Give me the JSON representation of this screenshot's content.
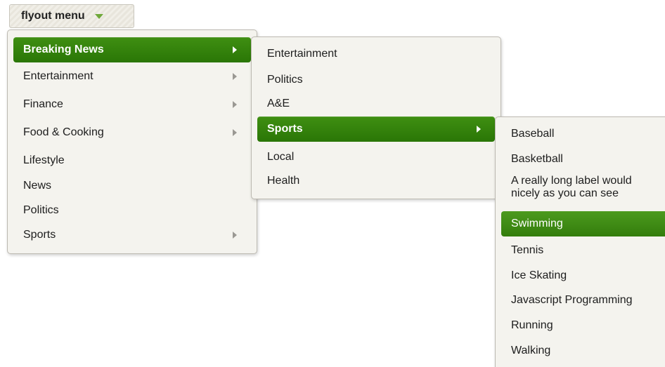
{
  "trigger": {
    "label": "flyout menu",
    "caret_icon": "caret-down-icon",
    "caret_color": "#6fa83a"
  },
  "colors": {
    "active_green": "#2f7a09",
    "panel_bg": "#f4f3ee"
  },
  "menu_level_1": {
    "items": [
      {
        "label": "Breaking News",
        "has_submenu": true,
        "active": true
      },
      {
        "label": "Entertainment",
        "has_submenu": true
      },
      {
        "label": "Finance",
        "has_submenu": true
      },
      {
        "label": "Food & Cooking",
        "has_submenu": true
      },
      {
        "label": "Lifestyle",
        "has_submenu": false
      },
      {
        "label": "News",
        "has_submenu": false
      },
      {
        "label": "Politics",
        "has_submenu": false
      },
      {
        "label": "Sports",
        "has_submenu": true
      }
    ]
  },
  "menu_level_2": {
    "items": [
      {
        "label": "Entertainment",
        "has_submenu": false
      },
      {
        "label": "Politics",
        "has_submenu": false
      },
      {
        "label": "A&E",
        "has_submenu": false
      },
      {
        "label": "Sports",
        "has_submenu": true,
        "active": true
      },
      {
        "label": "Local",
        "has_submenu": false
      },
      {
        "label": "Health",
        "has_submenu": false
      }
    ]
  },
  "menu_level_3": {
    "items": [
      {
        "label": "Baseball"
      },
      {
        "label": "Basketball"
      },
      {
        "label_line1": "A really long label would",
        "label_line2": "nicely as you can see"
      },
      {
        "label": "Swimming",
        "highlighted": true
      },
      {
        "label": "Tennis"
      },
      {
        "label": "Ice Skating"
      },
      {
        "label": "Javascript Programming"
      },
      {
        "label": "Running"
      },
      {
        "label": "Walking"
      }
    ]
  }
}
